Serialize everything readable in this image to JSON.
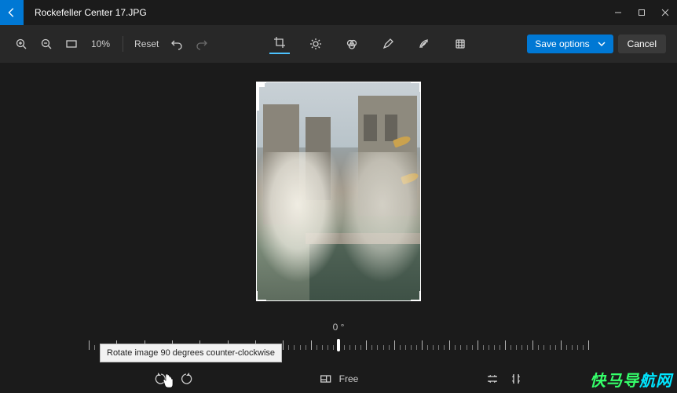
{
  "titlebar": {
    "filename": "Rockefeller Center 17.JPG"
  },
  "toolbar": {
    "zoom_pct": "10%",
    "reset": "Reset",
    "save_options": "Save options",
    "cancel": "Cancel"
  },
  "straighten": {
    "angle_label": "0 °",
    "min": -45,
    "max": 45,
    "value": 0
  },
  "aspect": {
    "free_label": "Free"
  },
  "tooltip": {
    "rotate_ccw": "Rotate image 90 degrees counter-clockwise"
  },
  "watermark": {
    "part1": "快马导",
    "part2": "航网"
  }
}
